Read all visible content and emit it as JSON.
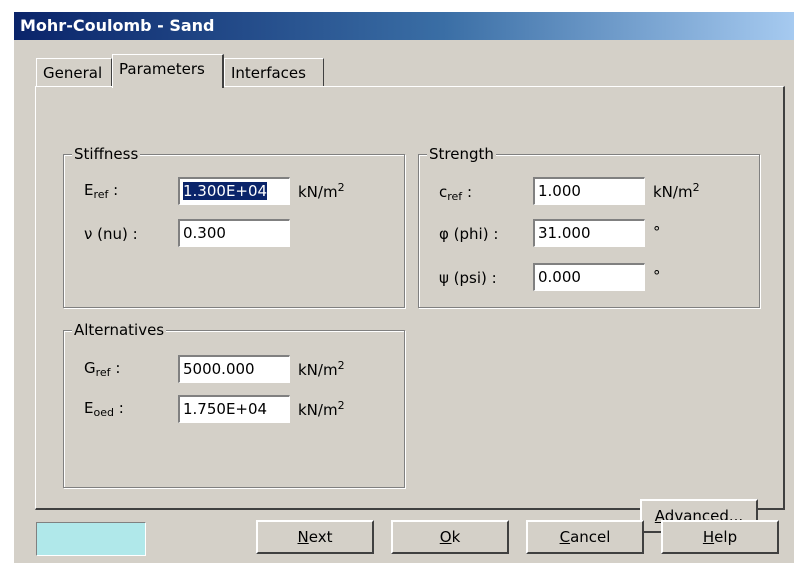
{
  "window": {
    "title": "Mohr-Coulomb - Sand"
  },
  "tabs": [
    {
      "label": "General"
    },
    {
      "label": "Parameters"
    },
    {
      "label": "Interfaces"
    }
  ],
  "stiffness": {
    "title": "Stiffness",
    "e_ref": {
      "symbol": "E",
      "sub": "ref",
      "suffix": " :",
      "value": "1.300E+04",
      "unit": "kN/m",
      "unit_sup": "2"
    },
    "nu": {
      "label": "ν (nu) :",
      "value": "0.300"
    }
  },
  "strength": {
    "title": "Strength",
    "c_ref": {
      "symbol": "c",
      "sub": "ref",
      "suffix": " :",
      "value": "1.000",
      "unit": "kN/m",
      "unit_sup": "2"
    },
    "phi": {
      "label": "φ (phi) :",
      "value": "31.000",
      "unit": "°"
    },
    "psi": {
      "label": "ψ (psi) :",
      "value": "0.000",
      "unit": "°"
    }
  },
  "alternatives": {
    "title": "Alternatives",
    "g_ref": {
      "symbol": "G",
      "sub": "ref",
      "suffix": " :",
      "value": "5000.000",
      "unit": "kN/m",
      "unit_sup": "2"
    },
    "e_oed": {
      "symbol": "E",
      "sub": "oed",
      "suffix": " :",
      "value": "1.750E+04",
      "unit": "kN/m",
      "unit_sup": "2"
    }
  },
  "buttons": {
    "advanced": {
      "mnemonic": "A",
      "rest": "dvanced..."
    },
    "next": {
      "mnemonic": "N",
      "rest": "ext"
    },
    "ok": {
      "mnemonic": "O",
      "rest": "k"
    },
    "cancel": {
      "mnemonic": "C",
      "rest": "ancel"
    },
    "help": {
      "mnemonic": "H",
      "rest": "elp"
    }
  },
  "colors": {
    "title_gradient_start": "#0a246a",
    "title_gradient_end": "#a6caf0",
    "face": "#d4d0c8",
    "swatch": "#b0e8ea"
  }
}
